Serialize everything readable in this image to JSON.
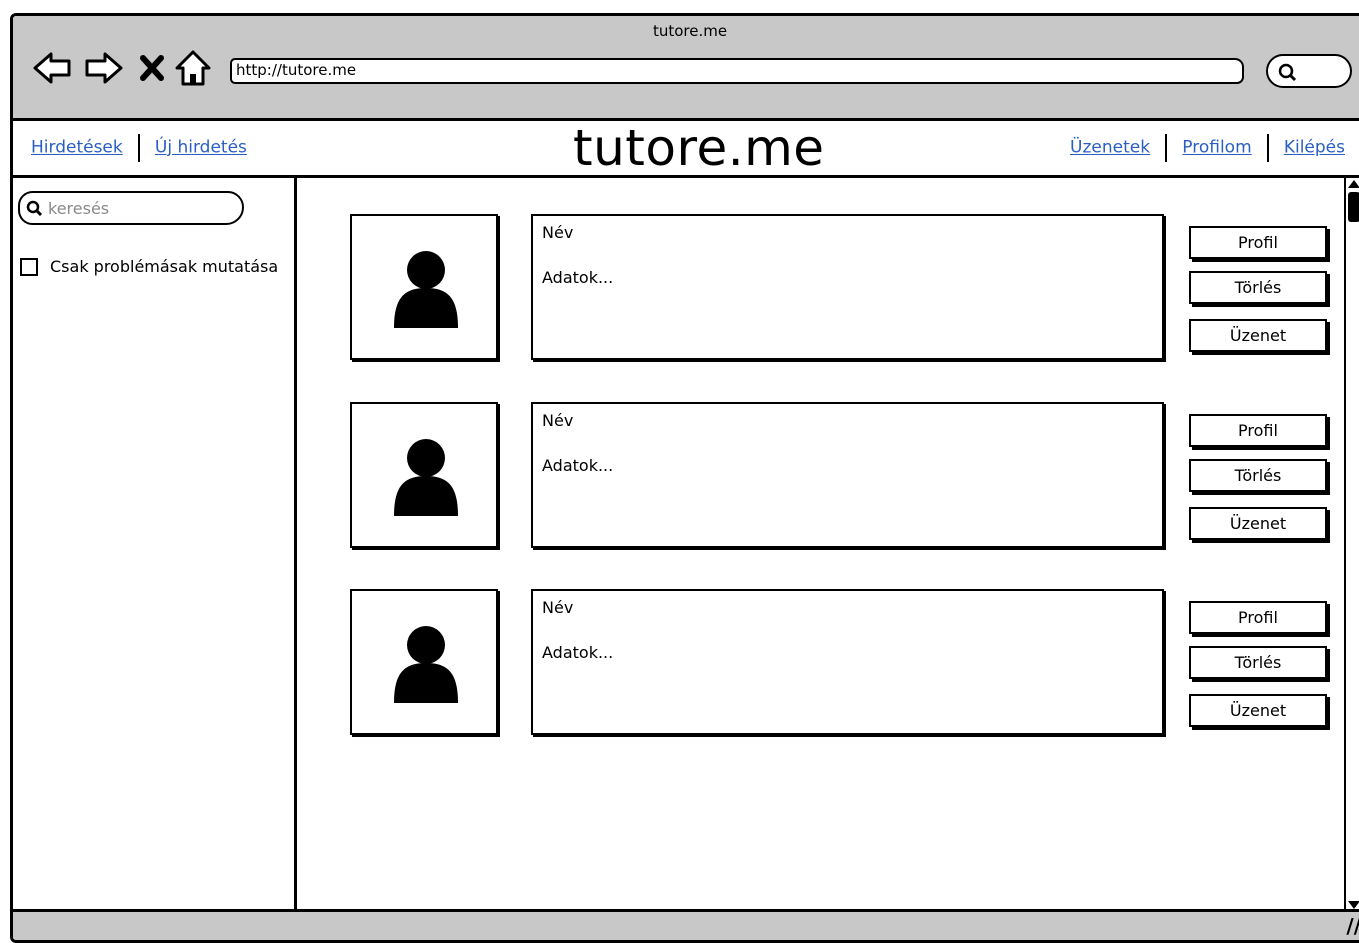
{
  "window": {
    "title": "tutore.me",
    "url": "http://tutore.me"
  },
  "topnav": {
    "left_links": [
      "Hirdetések",
      "Új hirdetés"
    ],
    "brand": "tutore.me",
    "right_links": [
      "Üzenetek",
      "Profilom",
      "Kilépés"
    ]
  },
  "sidebar": {
    "search_placeholder": "keresés",
    "filter_label": "Csak problémásak mutatása"
  },
  "listings": [
    {
      "name": "Név",
      "details": "Adatok...",
      "buttons": [
        "Profil",
        "Törlés",
        "Üzenet"
      ]
    },
    {
      "name": "Név",
      "details": "Adatok...",
      "buttons": [
        "Profil",
        "Törlés",
        "Üzenet"
      ]
    },
    {
      "name": "Név",
      "details": "Adatok...",
      "buttons": [
        "Profil",
        "Törlés",
        "Üzenet"
      ]
    }
  ]
}
